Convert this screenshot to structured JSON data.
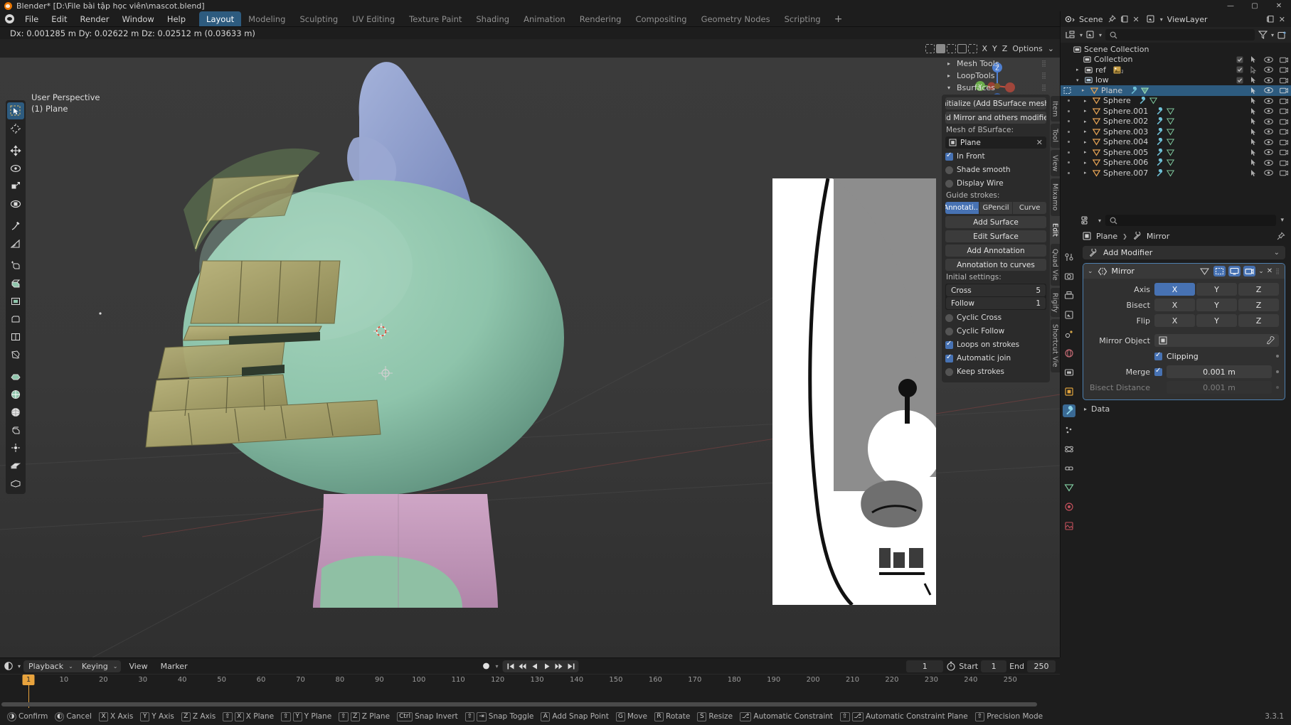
{
  "titlebar": {
    "title": "Blender* [D:\\File bài tập học viên\\mascot.blend]",
    "minimize": "—",
    "maximize": "▢",
    "close": "✕"
  },
  "topbar": {
    "menus": [
      "File",
      "Edit",
      "Render",
      "Window",
      "Help"
    ],
    "workspaces": [
      {
        "label": "Layout",
        "active": true
      },
      {
        "label": "Modeling",
        "active": false
      },
      {
        "label": "Sculpting",
        "active": false
      },
      {
        "label": "UV Editing",
        "active": false
      },
      {
        "label": "Texture Paint",
        "active": false
      },
      {
        "label": "Shading",
        "active": false
      },
      {
        "label": "Animation",
        "active": false
      },
      {
        "label": "Rendering",
        "active": false
      },
      {
        "label": "Compositing",
        "active": false
      },
      {
        "label": "Geometry Nodes",
        "active": false
      },
      {
        "label": "Scripting",
        "active": false
      }
    ],
    "add_workspace": "+"
  },
  "infobar": {
    "transform_readout": "Dx: 0.001285 m   Dy: 0.02622 m   Dz: 0.02512 m (0.03633 m)"
  },
  "viewport": {
    "perspective_label": "User Perspective",
    "object_label": "(1) Plane",
    "header": {
      "axis_letters": [
        "X",
        "Y",
        "Z"
      ],
      "options_label": "Options",
      "options_chevron": "⌄"
    },
    "side_tabs": [
      {
        "label": "Item",
        "active": false
      },
      {
        "label": "Tool",
        "active": false
      },
      {
        "label": "View",
        "active": false
      },
      {
        "label": "Mixamo",
        "active": false
      },
      {
        "label": "Edit",
        "active": true
      },
      {
        "label": "Quad Vie",
        "active": false
      },
      {
        "label": "Rigify",
        "active": false
      },
      {
        "label": "Shortcut Vie",
        "active": false
      }
    ],
    "tools": [
      {
        "name": "tweak-select-tool",
        "active": true
      },
      {
        "name": "cursor-tool",
        "active": false
      },
      {
        "name": "move-tool",
        "active": false
      },
      {
        "name": "rotate-tool",
        "active": false
      },
      {
        "name": "scale-tool",
        "active": false
      },
      {
        "name": "transform-tool",
        "active": false
      },
      {
        "name": "annotate-tool",
        "active": false
      },
      {
        "name": "measure-tool",
        "active": false
      },
      {
        "name": "add-cube-tool",
        "active": false
      },
      {
        "name": "extrude-region-tool",
        "active": false
      },
      {
        "name": "inset-faces-tool",
        "active": false
      },
      {
        "name": "bevel-tool",
        "active": false
      },
      {
        "name": "loop-cut-tool",
        "active": false
      },
      {
        "name": "knife-tool",
        "active": false
      },
      {
        "name": "poly-build-tool",
        "active": false
      },
      {
        "name": "spin-tool",
        "active": false
      },
      {
        "name": "smooth-tool",
        "active": false
      },
      {
        "name": "shrink-fatten-tool",
        "active": false
      },
      {
        "name": "shear-tool",
        "active": false
      },
      {
        "name": "rip-region-tool",
        "active": false
      }
    ]
  },
  "bsurfaces": {
    "sections": [
      {
        "label": "Mesh Tools",
        "open": false
      },
      {
        "label": "LoopTools",
        "open": false
      },
      {
        "label": "Bsurfaces",
        "open": true
      }
    ],
    "initialize_btn": "Initialize (Add BSurface mesh)",
    "add_mirror_btn": "Add Mirror and others modifiers",
    "mesh_label": "Mesh of BSurface:",
    "mesh_value": "Plane",
    "mesh_clear": "✕",
    "checks": [
      {
        "label": "In Front",
        "type": "check",
        "on": true
      },
      {
        "label": "Shade smooth",
        "type": "radio",
        "on": false
      },
      {
        "label": "Display Wire",
        "type": "radio",
        "on": false
      }
    ],
    "guide_label": "Guide strokes:",
    "guide_options": [
      {
        "label": "Annotati...",
        "on": true
      },
      {
        "label": "GPencil",
        "on": false
      },
      {
        "label": "Curve",
        "on": false
      }
    ],
    "add_surface_btn": "Add Surface",
    "edit_surface_btn": "Edit Surface",
    "add_annotation_btn": "Add Annotation",
    "annotation_to_curves_btn": "Annotation to curves",
    "initial_settings_label": "Initial settings:",
    "numbers": [
      {
        "label": "Cross",
        "value": "5"
      },
      {
        "label": "Follow",
        "value": "1"
      }
    ],
    "toggles": [
      {
        "label": "Cyclic Cross",
        "type": "radio",
        "on": false
      },
      {
        "label": "Cyclic Follow",
        "type": "radio",
        "on": false
      },
      {
        "label": "Loops on strokes",
        "type": "check",
        "on": true
      },
      {
        "label": "Automatic join",
        "type": "check",
        "on": true
      },
      {
        "label": "Keep strokes",
        "type": "radio",
        "on": false
      }
    ]
  },
  "outliner": {
    "scene_name": "Scene",
    "viewlayer_name": "ViewLayer",
    "search_placeholder": "",
    "rows": [
      {
        "label": "Scene Collection",
        "depth": 0,
        "icon": "collection-icon",
        "expand": "",
        "selected": false,
        "has_checkbox": false,
        "has_icons": false
      },
      {
        "label": "Collection",
        "depth": 1,
        "icon": "collection-icon",
        "expand": "",
        "selected": false,
        "has_checkbox": true,
        "has_icons": true
      },
      {
        "label": "ref",
        "depth": 1,
        "icon": "collection-icon",
        "expand": "▸",
        "selected": false,
        "has_checkbox": true,
        "has_icons": true,
        "badge": "image"
      },
      {
        "label": "low",
        "depth": 1,
        "icon": "collection-icon",
        "expand": "▾",
        "selected": false,
        "has_checkbox": true,
        "has_icons": true
      },
      {
        "label": "Plane",
        "depth": 2,
        "icon": "mesh-icon",
        "expand": "▸",
        "selected": true,
        "has_checkbox": false,
        "has_icons": true,
        "modifier": true
      },
      {
        "label": "Sphere",
        "depth": 2,
        "icon": "mesh-icon",
        "expand": "▸",
        "selected": false,
        "has_checkbox": false,
        "has_icons": true,
        "modifier": true
      },
      {
        "label": "Sphere.001",
        "depth": 2,
        "icon": "mesh-icon",
        "expand": "▸",
        "selected": false,
        "has_checkbox": false,
        "has_icons": true,
        "modifier": true
      },
      {
        "label": "Sphere.002",
        "depth": 2,
        "icon": "mesh-icon",
        "expand": "▸",
        "selected": false,
        "has_checkbox": false,
        "has_icons": true,
        "modifier": true
      },
      {
        "label": "Sphere.003",
        "depth": 2,
        "icon": "mesh-icon",
        "expand": "▸",
        "selected": false,
        "has_checkbox": false,
        "has_icons": true,
        "modifier": true
      },
      {
        "label": "Sphere.004",
        "depth": 2,
        "icon": "mesh-icon",
        "expand": "▸",
        "selected": false,
        "has_checkbox": false,
        "has_icons": true,
        "modifier": true
      },
      {
        "label": "Sphere.005",
        "depth": 2,
        "icon": "mesh-icon",
        "expand": "▸",
        "selected": false,
        "has_checkbox": false,
        "has_icons": true,
        "modifier": true
      },
      {
        "label": "Sphere.006",
        "depth": 2,
        "icon": "mesh-icon",
        "expand": "▸",
        "selected": false,
        "has_checkbox": false,
        "has_icons": true,
        "modifier": true
      },
      {
        "label": "Sphere.007",
        "depth": 2,
        "icon": "mesh-icon",
        "expand": "▸",
        "selected": false,
        "has_checkbox": false,
        "has_icons": true,
        "modifier": true
      }
    ]
  },
  "properties": {
    "breadcrumb_object": "Plane",
    "breadcrumb_sep": "❯",
    "breadcrumb_modifier": "Mirror",
    "add_modifier": "Add Modifier",
    "add_modifier_chevron": "⌄",
    "modifier": {
      "name": "Mirror",
      "collapse_chevron": "⌄",
      "close": "✕",
      "menu_chevron": "⌄",
      "axis_label": "Axis",
      "axis_options": [
        {
          "label": "X",
          "on": true
        },
        {
          "label": "Y",
          "on": false
        },
        {
          "label": "Z",
          "on": false
        }
      ],
      "bisect_label": "Bisect",
      "bisect_options": [
        {
          "label": "X",
          "on": false
        },
        {
          "label": "Y",
          "on": false
        },
        {
          "label": "Z",
          "on": false
        }
      ],
      "flip_label": "Flip",
      "flip_options": [
        {
          "label": "X",
          "on": false
        },
        {
          "label": "Y",
          "on": false
        },
        {
          "label": "Z",
          "on": false
        }
      ],
      "mirror_object_label": "Mirror Object",
      "mirror_object_value": "",
      "clipping_label": "Clipping",
      "clipping_on": true,
      "merge_label": "Merge",
      "merge_on": true,
      "merge_value": "0.001 m",
      "bisect_distance_label": "Bisect Distance",
      "bisect_distance_value": "0.001 m"
    },
    "data_section": "Data",
    "data_chevron": "▸"
  },
  "timeline": {
    "menus": [
      "Playback",
      "Keying",
      "View",
      "Marker"
    ],
    "playback_chevron": "⌄",
    "keying_chevron": "⌄",
    "current_frame": "1",
    "start_label": "Start",
    "start_value": "1",
    "end_label": "End",
    "end_value": "250",
    "ticks": [
      10,
      20,
      30,
      40,
      50,
      60,
      70,
      80,
      90,
      100,
      110,
      120,
      130,
      140,
      150,
      160,
      170,
      180,
      190,
      200,
      210,
      220,
      230,
      240,
      250
    ],
    "playhead_frame": "1"
  },
  "statusbar": {
    "items": [
      {
        "keys": [
          "◑"
        ],
        "label": "Confirm"
      },
      {
        "keys": [
          "◐"
        ],
        "label": "Cancel"
      },
      {
        "keys": [
          "X"
        ],
        "label": "X Axis"
      },
      {
        "keys": [
          "Y"
        ],
        "label": "Y Axis"
      },
      {
        "keys": [
          "Z"
        ],
        "label": "Z Axis"
      },
      {
        "keys": [
          "⇧",
          "X"
        ],
        "label": "X Plane"
      },
      {
        "keys": [
          "⇧",
          "Y"
        ],
        "label": "Y Plane"
      },
      {
        "keys": [
          "⇧",
          "Z"
        ],
        "label": "Z Plane"
      },
      {
        "keys": [
          "Ctrl"
        ],
        "label": "Snap Invert"
      },
      {
        "keys": [
          "⇧",
          "⇥"
        ],
        "label": "Snap Toggle"
      },
      {
        "keys": [
          "A"
        ],
        "label": "Add Snap Point"
      },
      {
        "keys": [
          "G"
        ],
        "label": "Move"
      },
      {
        "keys": [
          "R"
        ],
        "label": "Rotate"
      },
      {
        "keys": [
          "S"
        ],
        "label": "Resize"
      },
      {
        "keys": [
          "⎇"
        ],
        "label": "Automatic Constraint"
      },
      {
        "keys": [
          "⇧",
          "⎇"
        ],
        "label": "Automatic Constraint Plane"
      },
      {
        "keys": [
          "⇧"
        ],
        "label": "Precision Mode"
      }
    ],
    "version": "3.3.1"
  },
  "colors": {
    "accent": "#4772b3",
    "tab_active": "#2d5b7f",
    "panel_bg": "#2b2b2b",
    "editor_bg": "#1d1d1d",
    "viewport_bg": "#3b3b3b",
    "playhead": "#e8a33d",
    "mesh_orange": "#e6a355",
    "body_green": "#8fc5ac",
    "hat_blue": "#8e9fcf",
    "skirt_pink": "#c99fbe",
    "patch_olive": "#a8a16a"
  }
}
